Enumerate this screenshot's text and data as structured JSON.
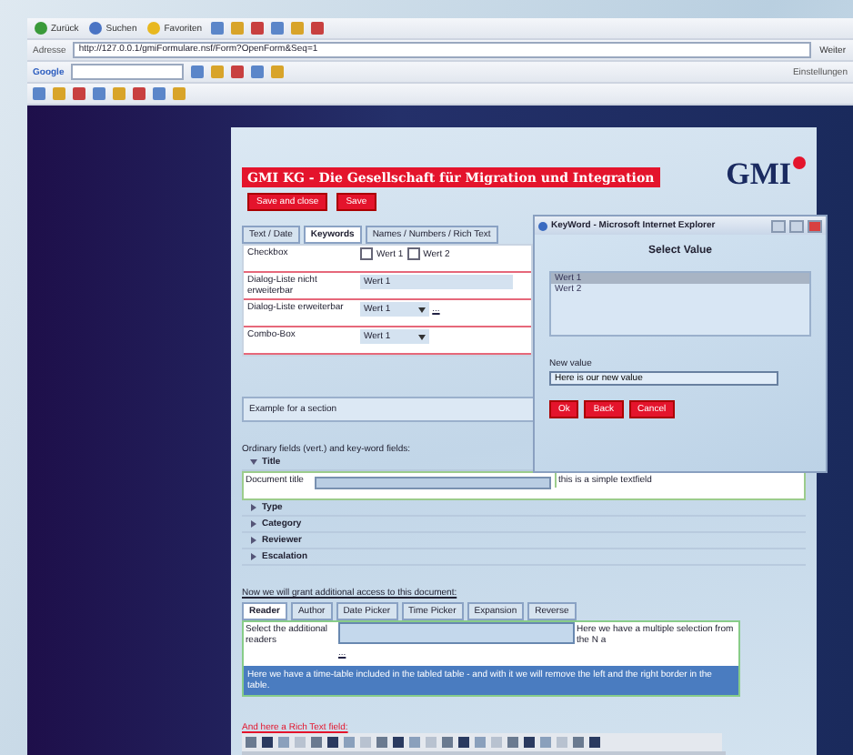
{
  "browser": {
    "toolbar": [
      {
        "label": "Zurück"
      },
      {
        "label": "Suchen"
      },
      {
        "label": "Favoriten"
      }
    ],
    "address_label": "Adresse",
    "address": "http://127.0.0.1/gmiFormulare.nsf/Form?OpenForm&Seq=1",
    "links_label": "Weiter",
    "google_label": "Google",
    "settings_label": "Einstellungen"
  },
  "header": {
    "title": "GMI KG - Die Gesellschaft für Migration und Integration",
    "logo": "GMI",
    "buttons": [
      "Save and close",
      "Save"
    ]
  },
  "tabs": [
    {
      "label": "Text / Date",
      "selected": false
    },
    {
      "label": "Keywords",
      "selected": true
    },
    {
      "label": "Names / Numbers / Rich Text",
      "selected": false
    }
  ],
  "keyword_rows": [
    {
      "kind": "checkbox",
      "label": "Checkbox",
      "options": [
        {
          "label": "Wert 1",
          "checked": false
        },
        {
          "label": "Wert 2",
          "checked": false
        }
      ]
    },
    {
      "kind": "list",
      "label": "Dialog-Liste nicht erweiterbar",
      "value": "Wert 1"
    },
    {
      "kind": "dropdown",
      "label": "Dialog-Liste erweiterbar",
      "value": "Wert 1",
      "extra": "..."
    },
    {
      "kind": "dropdown",
      "label": "Combo-Box",
      "value": "Wert 1"
    }
  ],
  "section_title": "Example for a section",
  "fields_heading": "Ordinary fields (vert.) and key-word fields:",
  "sections": [
    {
      "label": "Title",
      "expanded": true
    },
    {
      "label": "Type",
      "expanded": false
    },
    {
      "label": "Category",
      "expanded": false
    },
    {
      "label": "Reviewer",
      "expanded": false
    },
    {
      "label": "Escalation",
      "expanded": false
    }
  ],
  "document_title": {
    "label": "Document title",
    "hint": "this is a simple textfield"
  },
  "access_heading": "Now we will grant additional access to this document:",
  "access_tabs": [
    {
      "label": "Reader",
      "selected": true
    },
    {
      "label": "Author",
      "selected": false
    },
    {
      "label": "Date Picker",
      "selected": false
    },
    {
      "label": "Time Picker",
      "selected": false
    },
    {
      "label": "Expansion",
      "selected": false
    },
    {
      "label": "Reverse",
      "selected": false
    }
  ],
  "access_table": {
    "label": "Select the additional readers",
    "extra": "...",
    "hint": "Here we have a multiple selection from the N a",
    "note": "Here we have a time-table included in the tabled table - and with it we will remove the left and the right border in the table."
  },
  "rich_text_label": "And here a Rich Text field:",
  "popup": {
    "title": "KeyWord - Microsoft Internet Explorer",
    "heading": "Select Value",
    "items": [
      {
        "label": "Wert 1",
        "selected": true
      },
      {
        "label": "Wert 2",
        "selected": false
      }
    ],
    "new_value_label": "New value",
    "new_value": "Here is our new value",
    "buttons": [
      "Ok",
      "Back",
      "Cancel"
    ]
  }
}
